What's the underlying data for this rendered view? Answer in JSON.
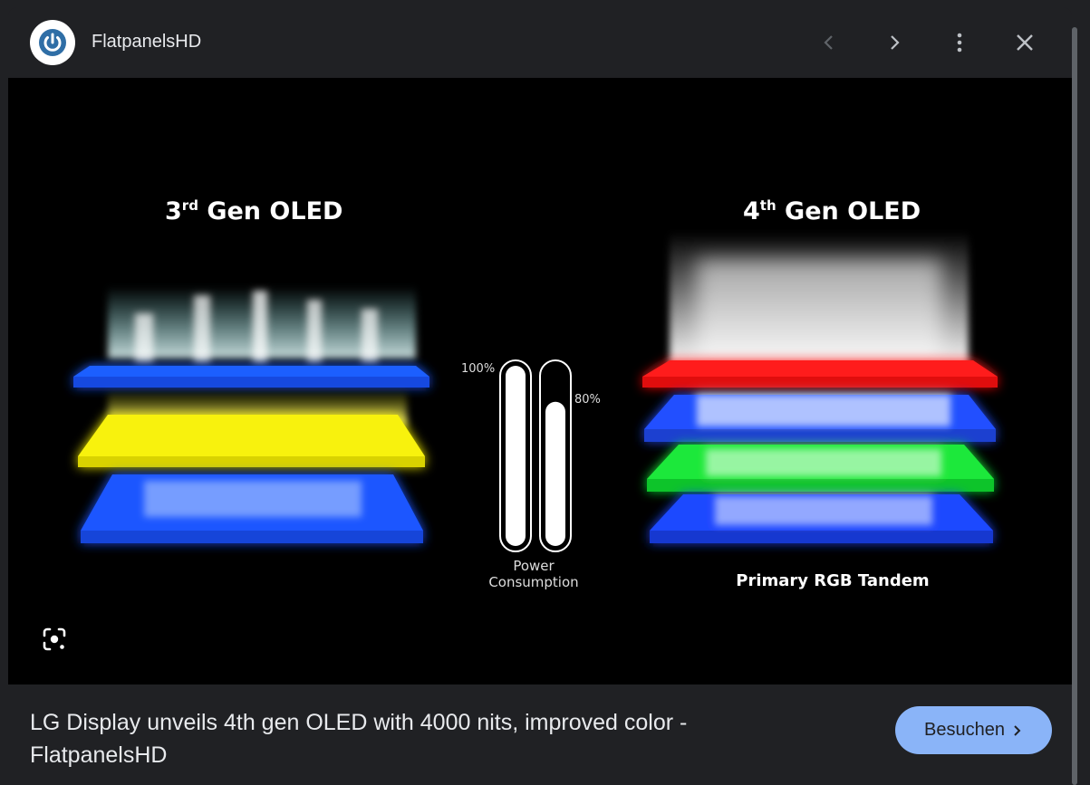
{
  "header": {
    "site_name": "FlatpanelsHD",
    "favicon_icon": "power-icon",
    "prev_icon": "chevron-left-icon",
    "next_icon": "chevron-right-icon",
    "more_icon": "more-vert-icon",
    "close_icon": "close-icon"
  },
  "image": {
    "left_title_main": "3",
    "left_title_sup": "rd",
    "left_title_rest": " Gen OLED",
    "right_title_main": "4",
    "right_title_sup": "th",
    "right_title_rest": " Gen OLED",
    "pct_100": "100%",
    "pct_80": "80%",
    "power_line1": "Power",
    "power_line2": "Consumption",
    "rgb_label": "Primary RGB Tandem",
    "lens_icon": "google-lens-icon",
    "bar1_level": 1.0,
    "bar2_level": 0.8
  },
  "footer": {
    "title": "LG Display unveils 4th gen OLED with 4000 nits, improved color - FlatpanelsHD",
    "visit_label": "Besuchen",
    "visit_icon": "chevron-right-icon"
  },
  "colors": {
    "background": "#202124",
    "accent": "#8ab4f8",
    "favicon": "#1a73e8"
  }
}
